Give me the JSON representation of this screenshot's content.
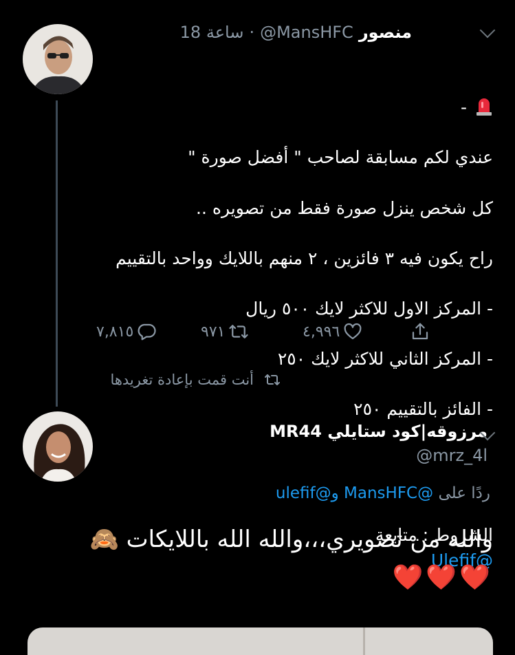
{
  "tweet": {
    "name": "منصور",
    "handle": "@MansHFC",
    "time": "18 ساعة",
    "prefix": " -",
    "lines": [
      "عندي لكم مسابقة لصاحب \" أفضل صورة \"",
      "كل شخص ينزل صورة فقط من تصويره  ..",
      "راح يكون فيه ٣ فائزين ، ٢ منهم باللايك وواحد بالتقييم",
      "- المركز الاول للاكثر لايك ٥٠٠ ريال",
      "- المركز الثاني للاكثر لايك ٢٥٠",
      "- الفائز بالتقييم ٢٥٠"
    ],
    "conditions_label": "الشروط : متابعة",
    "conditions_mention": "@Ulefif",
    "replies": "٧,٨١٥",
    "retweets": "٩٧١",
    "likes": "٤,٩٩٦"
  },
  "retweeted_note": "أنت قمت بإعادة تغريدها",
  "reply": {
    "name": "مرزوقه|كود ستايلي MR44",
    "handle": "@mrz_4l",
    "replying_label": "ردًا على",
    "replying_to": "@MansHFC",
    "and_label": "و",
    "replying_to_2": "@ulefif",
    "text": "والله من تصويري،،،والله الله باللايكات 🙈",
    "hearts": "❤️❤️❤️"
  },
  "colors": {
    "background": "#000000",
    "accent": "#1d9bf0",
    "secondary": "#8b98a5"
  },
  "icons": [
    "siren-emoji",
    "reply-icon",
    "retweet-icon",
    "like-icon",
    "share-icon",
    "chevron-down-icon"
  ]
}
